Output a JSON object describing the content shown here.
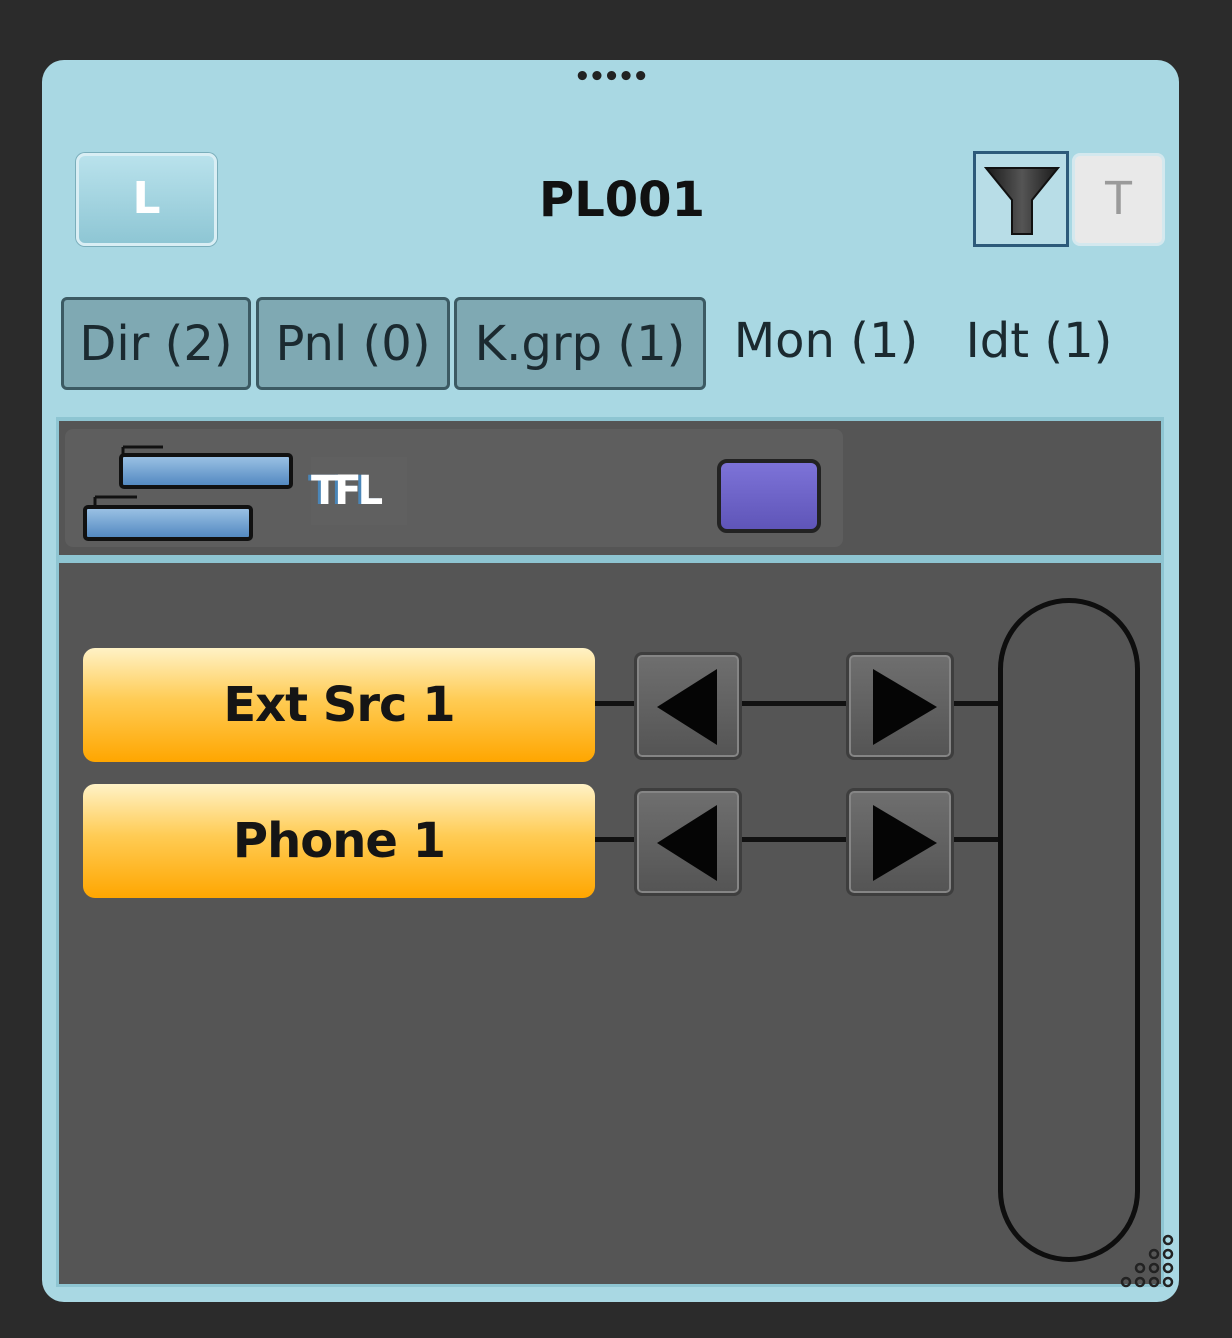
{
  "panel": {
    "drag_handle": "•••••",
    "left_button": "L",
    "title": "PL001",
    "filter_icon": "funnel-icon",
    "t_button": "T"
  },
  "tabs": [
    {
      "label": "Dir (2)"
    },
    {
      "label": "Pnl (0)"
    },
    {
      "label": "K.grp (1)"
    },
    {
      "label": "Mon (1)"
    },
    {
      "label": "Idt (1)"
    }
  ],
  "group": {
    "icon": "group-layers-icon",
    "label": "TFL",
    "swatch_color": "#6b62c8"
  },
  "sources": [
    {
      "label": "Ext Src 1"
    },
    {
      "label": "Phone 1"
    }
  ],
  "colors": {
    "panel_bg": "#a9d8e3",
    "content_bg": "#555555",
    "source_gradient_top": "#fff2c6",
    "source_gradient_bottom": "#ffa600"
  }
}
